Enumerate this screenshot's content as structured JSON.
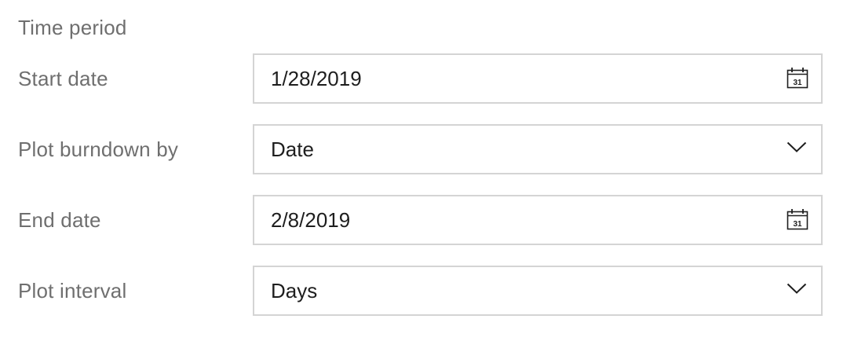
{
  "section": {
    "title": "Time period"
  },
  "fields": [
    {
      "label": "Start date",
      "value": "1/28/2019",
      "control": "date-picker",
      "icon": "calendar-icon",
      "icon_text": "31"
    },
    {
      "label": "Plot burndown by",
      "value": "Date",
      "control": "dropdown",
      "icon": "chevron-down-icon"
    },
    {
      "label": "End date",
      "value": "2/8/2019",
      "control": "date-picker",
      "icon": "calendar-icon",
      "icon_text": "31"
    },
    {
      "label": "Plot interval",
      "value": "Days",
      "control": "dropdown",
      "icon": "chevron-down-icon"
    }
  ],
  "colors": {
    "label_text": "#6f6f6f",
    "value_text": "#1e1e1e",
    "field_border": "#d4d4d4",
    "icon": "#1e1e1e"
  }
}
